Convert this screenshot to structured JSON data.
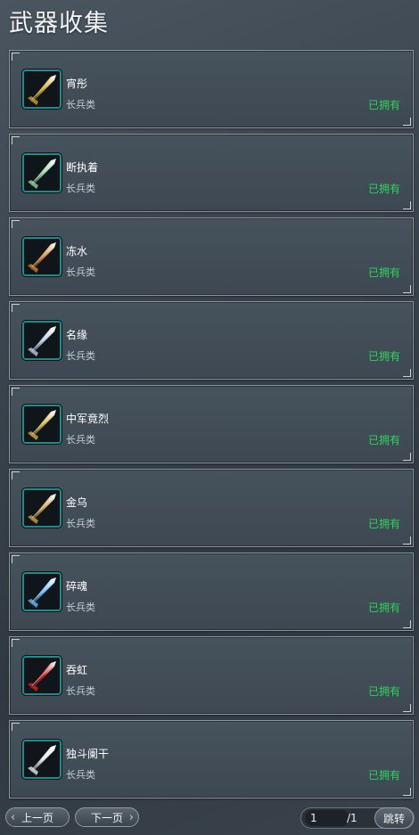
{
  "title": "武器收集",
  "weapons": [
    {
      "name": "宵彤",
      "type": "长兵类",
      "status": "已拥有",
      "icon": "golden-blade-icon",
      "color": "#c9a22a"
    },
    {
      "name": "断执着",
      "type": "长兵类",
      "status": "已拥有",
      "icon": "jade-blade-icon",
      "color": "#8fd0a0"
    },
    {
      "name": "冻水",
      "type": "长兵类",
      "status": "已拥有",
      "icon": "bronze-spear-icon",
      "color": "#d08030"
    },
    {
      "name": "名缘",
      "type": "长兵类",
      "status": "已拥有",
      "icon": "silver-blade-icon",
      "color": "#b8c8e0"
    },
    {
      "name": "中军竟烈",
      "type": "长兵类",
      "status": "已拥有",
      "icon": "trident-icon",
      "color": "#d0b040"
    },
    {
      "name": "金乌",
      "type": "长兵类",
      "status": "已拥有",
      "icon": "golden-spear-icon",
      "color": "#c8a040"
    },
    {
      "name": "碎魂",
      "type": "长兵类",
      "status": "已拥有",
      "icon": "ice-blade-icon",
      "color": "#60b8ff"
    },
    {
      "name": "吞虹",
      "type": "长兵类",
      "status": "已拥有",
      "icon": "crimson-blade-icon",
      "color": "#d02020"
    },
    {
      "name": "独斗阑干",
      "type": "长兵类",
      "status": "已拥有",
      "icon": "white-blade-icon",
      "color": "#e0e4e8"
    }
  ],
  "pager": {
    "prev_label": "上一页",
    "next_label": "下一页",
    "current_page": "1",
    "total_pages": "/1",
    "jump_label": "跳转"
  }
}
